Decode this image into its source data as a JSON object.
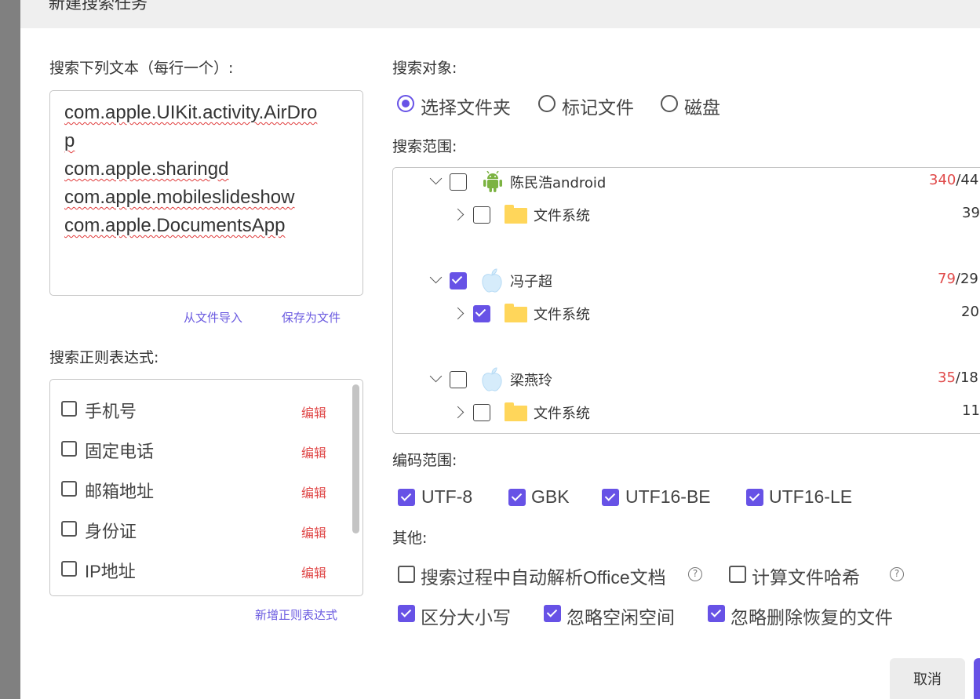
{
  "dialog": {
    "title": "新建搜索任务"
  },
  "search_text": {
    "label": "搜索下列文本（每行一个）:",
    "lines": [
      "com.apple.UIKit.activity.AirDro",
      "p",
      "com.apple.sharingd",
      "com.apple.mobileslideshow",
      "com.apple.DocumentsApp"
    ],
    "import_link": "从文件导入",
    "save_link": "保存为文件"
  },
  "regex": {
    "label": "搜索正则表达式:",
    "items": [
      {
        "label": "手机号",
        "edit": "编辑",
        "checked": false
      },
      {
        "label": "固定电话",
        "edit": "编辑",
        "checked": false
      },
      {
        "label": "邮箱地址",
        "edit": "编辑",
        "checked": false
      },
      {
        "label": "身份证",
        "edit": "编辑",
        "checked": false
      },
      {
        "label": "IP地址",
        "edit": "编辑",
        "checked": false
      }
    ],
    "add_link": "新增正则表达式"
  },
  "target": {
    "label": "搜索对象:",
    "options": [
      {
        "label": "选择文件夹",
        "selected": true
      },
      {
        "label": "标记文件",
        "selected": false
      },
      {
        "label": "磁盘",
        "selected": false
      }
    ]
  },
  "scope": {
    "label": "搜索范围:",
    "tree": [
      {
        "name": "陈民浩android",
        "icon": "android-icon",
        "checked": false,
        "count_red": "340",
        "count_rest": "/44",
        "child": {
          "name": "文件系统",
          "icon": "folder-icon",
          "checked": false,
          "count": "39"
        }
      },
      {
        "name": "冯子超",
        "icon": "apple-icon",
        "checked": true,
        "count_red": "79",
        "count_rest": "/29",
        "child": {
          "name": "文件系统",
          "icon": "folder-icon",
          "checked": true,
          "count": "20"
        }
      },
      {
        "name": "梁燕玲",
        "icon": "apple-icon",
        "checked": false,
        "count_red": "35",
        "count_rest": "/18",
        "child": {
          "name": "文件系统",
          "icon": "folder-icon",
          "checked": false,
          "count": "11"
        }
      }
    ]
  },
  "encoding": {
    "label": "编码范围:",
    "items": [
      {
        "label": "UTF-8",
        "checked": true
      },
      {
        "label": "GBK",
        "checked": true
      },
      {
        "label": "UTF16-BE",
        "checked": true
      },
      {
        "label": "UTF16-LE",
        "checked": true
      }
    ]
  },
  "other": {
    "label": "其他:",
    "items": [
      {
        "label": "搜索过程中自动解析Office文档",
        "checked": false,
        "help": "?"
      },
      {
        "label": "计算文件哈希",
        "checked": false,
        "help": "?"
      },
      {
        "label": "区分大小写",
        "checked": true
      },
      {
        "label": "忽略空闲空间",
        "checked": true
      },
      {
        "label": "忽略删除恢复的文件",
        "checked": true
      }
    ]
  },
  "footer": {
    "cancel_label": "取消"
  },
  "colors": {
    "accent": "#6752e6",
    "danger": "#e04a4a",
    "link": "#6a5ae0"
  }
}
